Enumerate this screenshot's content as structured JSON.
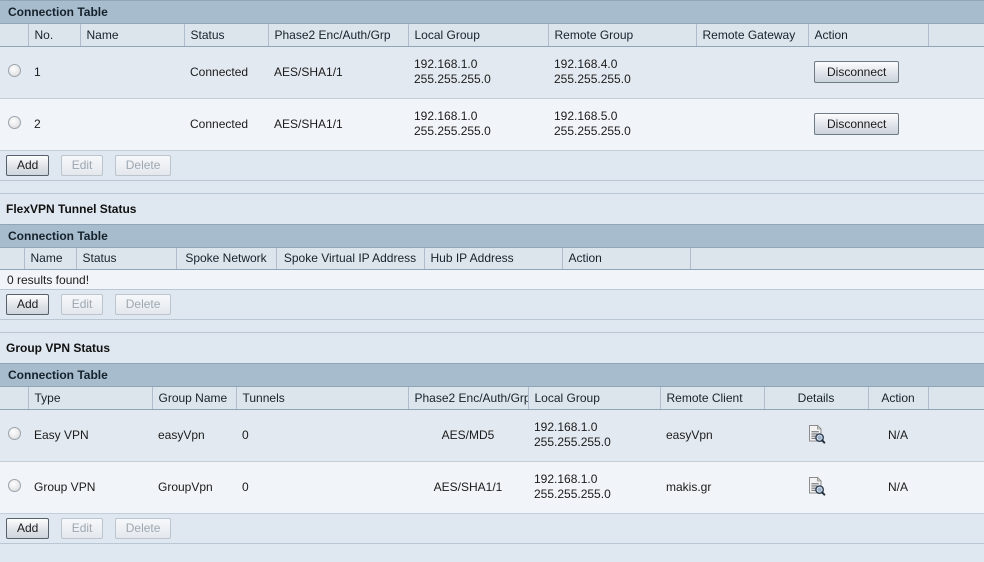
{
  "colors": {
    "caption_bg": "#a7bccd",
    "header_bg": "#dde5ec",
    "row_a": "#e3e9f0",
    "row_b": "#f1f4f8",
    "page_bg": "#dfe8f0"
  },
  "sections": {
    "vpn": {
      "caption": "Connection Table",
      "columns": [
        "",
        "No.",
        "Name",
        "Status",
        "Phase2 Enc/Auth/Grp",
        "Local Group",
        "Remote Group",
        "Remote Gateway",
        "Action",
        ""
      ],
      "rows": [
        {
          "no": "1",
          "name": "",
          "status": "Connected",
          "phase2": "AES/SHA1/1",
          "local_ip": "192.168.1.0",
          "local_mask": "255.255.255.0",
          "remote_ip": "192.168.4.0",
          "remote_mask": "255.255.255.0",
          "remote_gateway": "",
          "action": "Disconnect"
        },
        {
          "no": "2",
          "name": "",
          "status": "Connected",
          "phase2": "AES/SHA1/1",
          "local_ip": "192.168.1.0",
          "local_mask": "255.255.255.0",
          "remote_ip": "192.168.5.0",
          "remote_mask": "255.255.255.0",
          "remote_gateway": "",
          "action": "Disconnect"
        }
      ],
      "buttons": {
        "add": "Add",
        "edit": "Edit",
        "delete": "Delete"
      }
    },
    "flexvpn": {
      "title": "FlexVPN Tunnel Status",
      "caption": "Connection Table",
      "columns": [
        "",
        "Name",
        "Status",
        "Spoke Network",
        "Spoke Virtual IP Address",
        "Hub IP Address",
        "Action",
        ""
      ],
      "empty_message": "0 results found!",
      "buttons": {
        "add": "Add",
        "edit": "Edit",
        "delete": "Delete"
      }
    },
    "groupvpn": {
      "title": "Group VPN Status",
      "caption": "Connection Table",
      "columns": [
        "",
        "Type",
        "Group Name",
        "Tunnels",
        "Phase2 Enc/Auth/Grp",
        "Local Group",
        "Remote Client",
        "Details",
        "Action",
        ""
      ],
      "rows": [
        {
          "type": "Easy VPN",
          "group_name": "easyVpn",
          "tunnels": "0",
          "phase2": "AES/MD5",
          "local_ip": "192.168.1.0",
          "local_mask": "255.255.255.0",
          "remote_client": "easyVpn",
          "details_icon": "document-search-icon",
          "action": "N/A"
        },
        {
          "type": "Group VPN",
          "group_name": "GroupVpn",
          "tunnels": "0",
          "phase2": "AES/SHA1/1",
          "local_ip": "192.168.1.0",
          "local_mask": "255.255.255.0",
          "remote_client": "makis.gr",
          "details_icon": "document-search-icon",
          "action": "N/A"
        }
      ],
      "buttons": {
        "add": "Add",
        "edit": "Edit",
        "delete": "Delete"
      }
    }
  }
}
